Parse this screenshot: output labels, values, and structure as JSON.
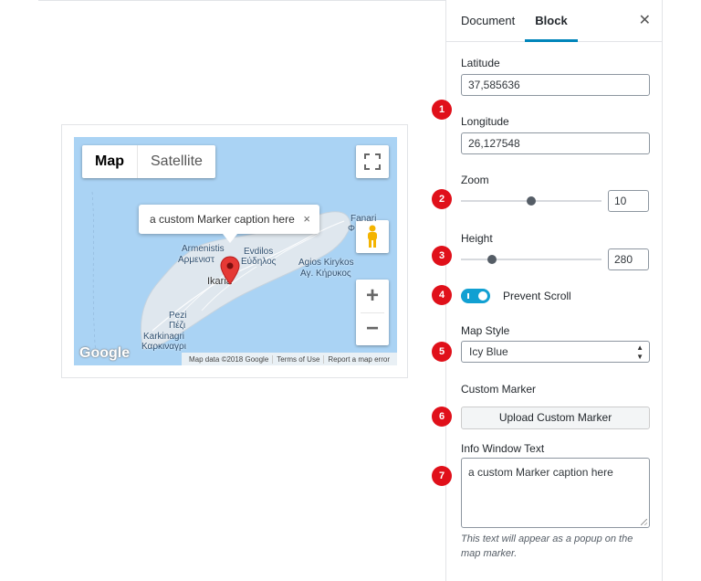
{
  "map": {
    "maptype": {
      "map_label": "Map",
      "satellite_label": "Satellite"
    },
    "info_window": {
      "text": "a custom Marker caption here",
      "close": "×"
    },
    "places": {
      "armenistis": "Armenistis",
      "armenistis_gr": "Αρμενιστ",
      "evdilos": "Evdilos",
      "evdilos_gr": "Εύδηλος",
      "agios": "Agios Kirykos",
      "agios_gr": "Αγ. Κήρυκος",
      "fanari": "Fanari",
      "fanari_gr": "Φ",
      "ikaria": "Ikaria",
      "pezi": "Pezi",
      "pezi_gr": "Πέζι",
      "karkinagri": "Karkinagri",
      "karkinagri_gr": "Καρκιναγρι"
    },
    "google_logo": "Google",
    "attribution": {
      "data": "Map data ©2018 Google",
      "terms": "Terms of Use",
      "report": "Report a map error"
    },
    "zoom_in": "+",
    "zoom_out": "−"
  },
  "sidebar": {
    "tabs": {
      "document": "Document",
      "block": "Block"
    },
    "close": "✕",
    "latitude": {
      "label": "Latitude",
      "value": "37,585636"
    },
    "longitude": {
      "label": "Longitude",
      "value": "26,127548"
    },
    "zoom": {
      "label": "Zoom",
      "value": "10",
      "level": 0.5
    },
    "height": {
      "label": "Height",
      "value": "280",
      "level": 0.2
    },
    "prevent_scroll": {
      "label": "Prevent Scroll",
      "on": true
    },
    "map_style": {
      "label": "Map Style",
      "value": "Icy Blue"
    },
    "custom_marker": {
      "label": "Custom Marker",
      "button": "Upload Custom Marker"
    },
    "info_window": {
      "label": "Info Window Text",
      "value": "a custom Marker caption here",
      "help": "This text will appear as a popup on the map marker."
    }
  },
  "badges": [
    "1",
    "2",
    "3",
    "4",
    "5",
    "6",
    "7"
  ],
  "colors": {
    "badge": "#e0101a",
    "accent": "#0085ba",
    "toggle": "#11a0d2",
    "water": "#aad3f4",
    "land": "#dfe7ee",
    "marker": "#e53935"
  }
}
